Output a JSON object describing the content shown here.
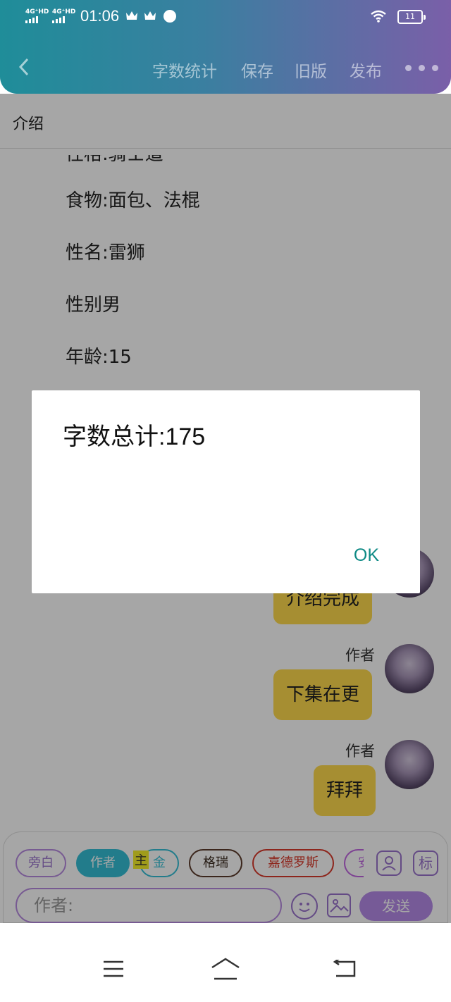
{
  "status_bar": {
    "signal1": "4G⁺HD",
    "signal2": "4G⁺HD",
    "time": "01:06",
    "battery": "11"
  },
  "nav": {
    "word_count": "字数统计",
    "save": "保存",
    "old_version": "旧版",
    "publish": "发布"
  },
  "document": {
    "title": "介绍",
    "lines": [
      "性格:骑士道",
      "食物:面包、法棍",
      "性名:雷狮",
      "性别男",
      "年龄:15"
    ]
  },
  "messages": [
    {
      "text": "介绍完成"
    },
    {
      "author": "作者",
      "text": "下集在更"
    },
    {
      "author": "作者",
      "text": "拜拜"
    }
  ],
  "chips": [
    "旁白",
    "作者",
    "金",
    "格瑞",
    "嘉德罗斯",
    "安"
  ],
  "chip_highlight": "主",
  "side_icon_label": "标",
  "input": {
    "placeholder": "作者:"
  },
  "send_label": "发送",
  "dialog": {
    "message": "字数总计:175",
    "ok": "OK"
  },
  "colors": {
    "accent_purple": "#b58ae8",
    "active_chip": "#35bfd6",
    "bubble": "#ffdb4d",
    "ok_text": "#0e8a85"
  }
}
